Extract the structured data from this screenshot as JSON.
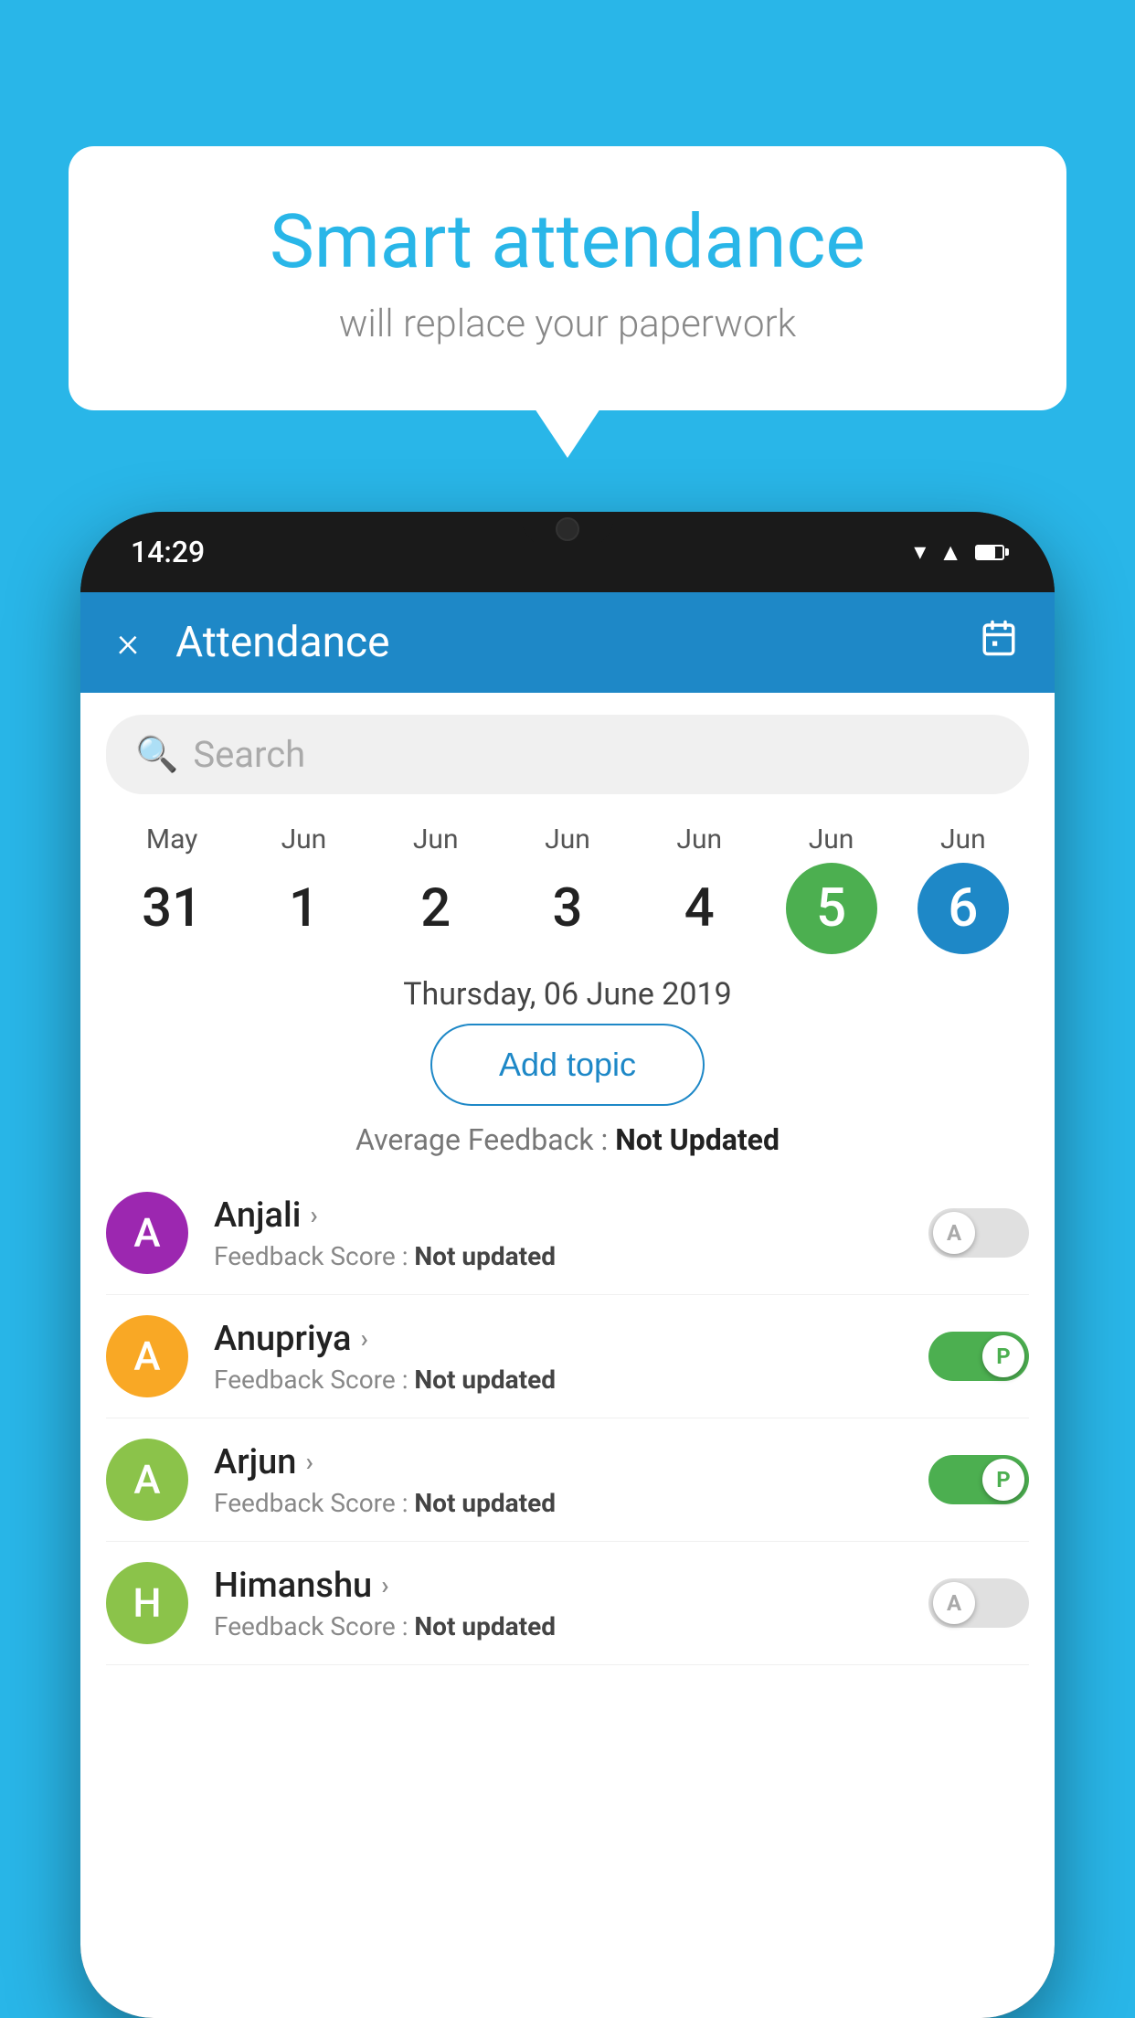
{
  "background_color": "#29b6e8",
  "bubble": {
    "title": "Smart attendance",
    "subtitle": "will replace your paperwork"
  },
  "phone": {
    "status_bar": {
      "time": "14:29"
    },
    "header": {
      "title": "Attendance",
      "close_label": "×",
      "calendar_icon": "📅"
    },
    "search": {
      "placeholder": "Search"
    },
    "calendar": {
      "days": [
        {
          "month": "May",
          "date": "31",
          "state": "normal"
        },
        {
          "month": "Jun",
          "date": "1",
          "state": "normal"
        },
        {
          "month": "Jun",
          "date": "2",
          "state": "normal"
        },
        {
          "month": "Jun",
          "date": "3",
          "state": "normal"
        },
        {
          "month": "Jun",
          "date": "4",
          "state": "normal"
        },
        {
          "month": "Jun",
          "date": "5",
          "state": "today"
        },
        {
          "month": "Jun",
          "date": "6",
          "state": "selected"
        }
      ]
    },
    "selected_date_label": "Thursday, 06 June 2019",
    "add_topic_label": "Add topic",
    "feedback_summary_prefix": "Average Feedback : ",
    "feedback_summary_value": "Not Updated",
    "students": [
      {
        "name": "Anjali",
        "avatar_letter": "A",
        "avatar_color": "#9c27b0",
        "feedback_label": "Feedback Score : ",
        "feedback_value": "Not updated",
        "toggle_state": "off",
        "toggle_letter": "A"
      },
      {
        "name": "Anupriya",
        "avatar_letter": "A",
        "avatar_color": "#f9a825",
        "feedback_label": "Feedback Score : ",
        "feedback_value": "Not updated",
        "toggle_state": "on",
        "toggle_letter": "P"
      },
      {
        "name": "Arjun",
        "avatar_letter": "A",
        "avatar_color": "#8bc34a",
        "feedback_label": "Feedback Score : ",
        "feedback_value": "Not updated",
        "toggle_state": "on",
        "toggle_letter": "P"
      },
      {
        "name": "Himanshu",
        "avatar_letter": "H",
        "avatar_color": "#8bc34a",
        "feedback_label": "Feedback Score : ",
        "feedback_value": "Not updated",
        "toggle_state": "off",
        "toggle_letter": "A"
      }
    ]
  }
}
